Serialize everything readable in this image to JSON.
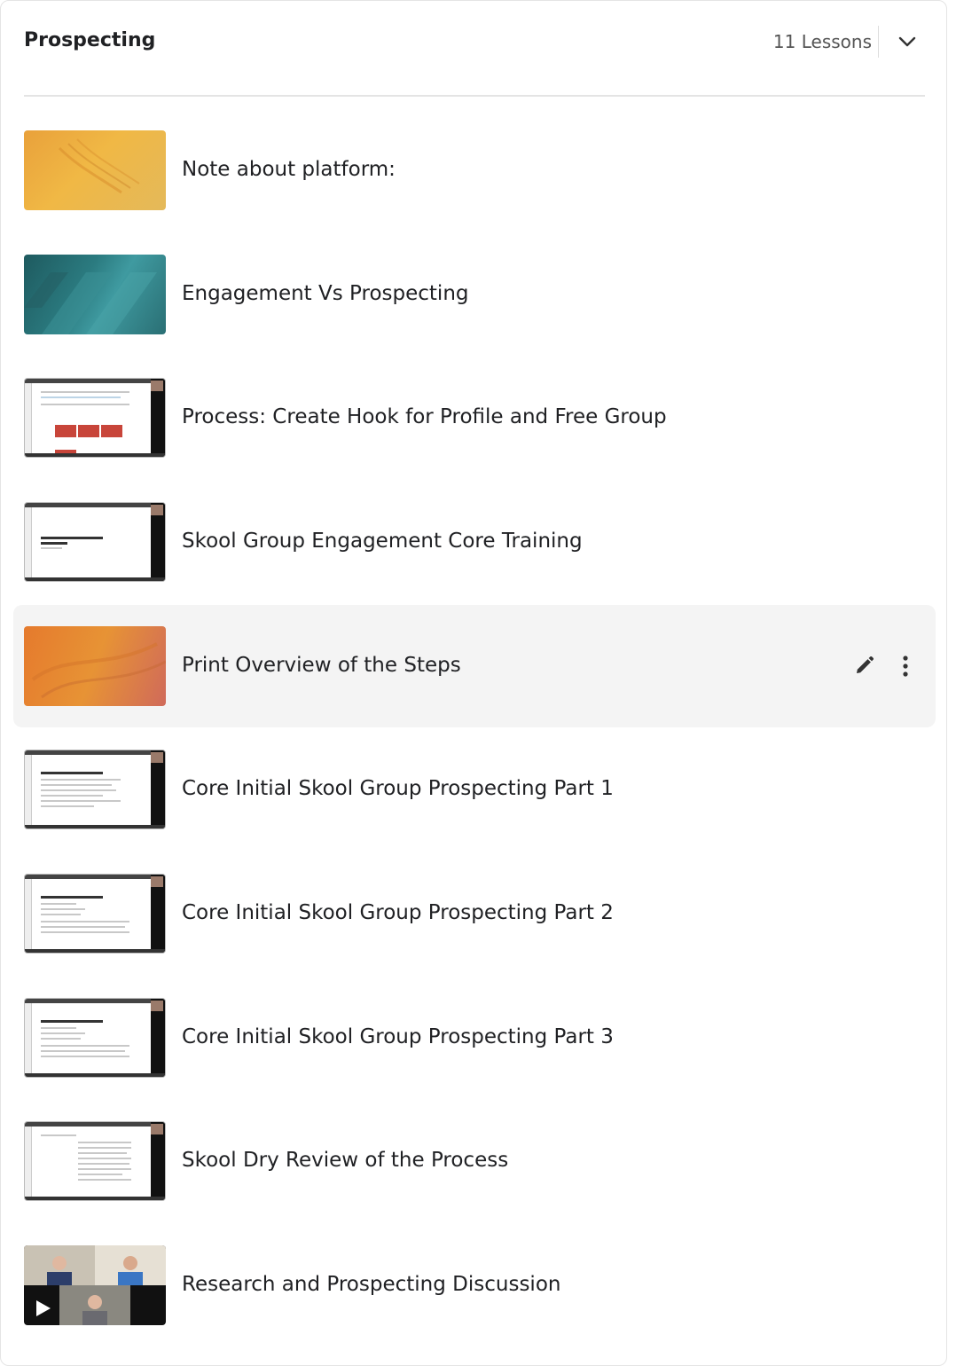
{
  "module": {
    "title": "Prospecting",
    "lesson_count": "11 Lessons"
  },
  "lessons": [
    {
      "label": "Note about platform:",
      "thumb": "orange-abstract"
    },
    {
      "label": "Engagement Vs Prospecting",
      "thumb": "teal-abstract"
    },
    {
      "label": "Process: Create Hook for Profile and Free Group",
      "thumb": "screen-recording"
    },
    {
      "label": "Skool Group Engagement Core Training",
      "thumb": "screen-recording"
    },
    {
      "label": "Print Overview of the Steps",
      "thumb": "orange-abstract",
      "active": true
    },
    {
      "label": "Core Initial Skool Group Prospecting Part 1",
      "thumb": "screen-recording"
    },
    {
      "label": "Core Initial Skool Group Prospecting Part 2",
      "thumb": "screen-recording"
    },
    {
      "label": "Core Initial Skool Group Prospecting Part 3",
      "thumb": "screen-recording"
    },
    {
      "label": "Skool Dry Review of the Process",
      "thumb": "screen-recording"
    },
    {
      "label": "Research and Prospecting Discussion",
      "thumb": "video-call"
    }
  ],
  "icons": {
    "collapse": "chevron-down-icon",
    "edit": "pencil-icon",
    "more": "more-vertical-icon",
    "play": "play-icon"
  }
}
